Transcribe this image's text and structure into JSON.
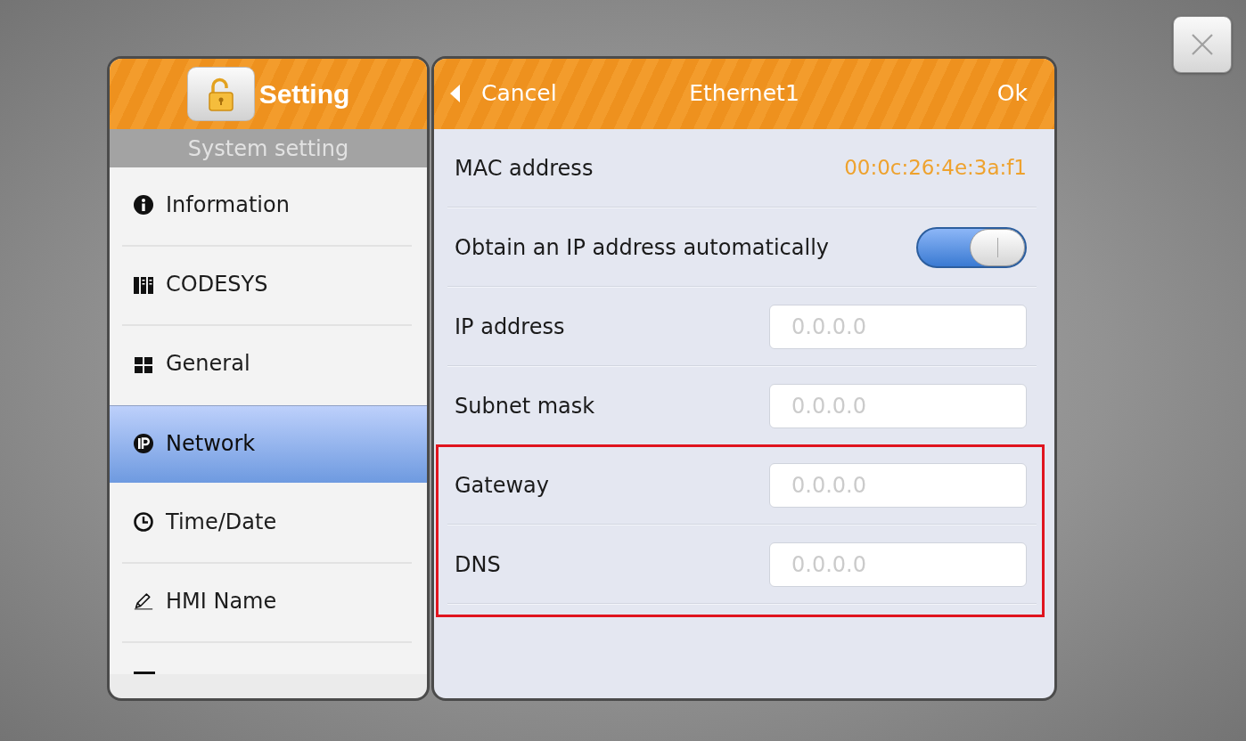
{
  "sidebar": {
    "title": "Setting",
    "subtitle": "System setting",
    "items": [
      {
        "label": "Information",
        "selected": false
      },
      {
        "label": "CODESYS",
        "selected": false
      },
      {
        "label": "General",
        "selected": false
      },
      {
        "label": "Network",
        "selected": true
      },
      {
        "label": "Time/Date",
        "selected": false
      },
      {
        "label": "HMI Name",
        "selected": false
      }
    ]
  },
  "detail": {
    "cancel": "Cancel",
    "title": "Ethernet1",
    "ok": "Ok",
    "fields": [
      {
        "kind": "info",
        "label": "MAC address",
        "value": "00:0c:26:4e:3a:f1",
        "highlighted": false
      },
      {
        "kind": "toggle",
        "label": "Obtain an IP address automatically",
        "on": true,
        "highlighted": false
      },
      {
        "kind": "input",
        "label": "IP address",
        "placeholder": "0.0.0.0",
        "highlighted": false
      },
      {
        "kind": "input",
        "label": "Subnet mask",
        "placeholder": "0.0.0.0",
        "highlighted": false
      },
      {
        "kind": "input",
        "label": "Gateway",
        "placeholder": "0.0.0.0",
        "highlighted": true
      },
      {
        "kind": "input",
        "label": "DNS",
        "placeholder": "0.0.0.0",
        "highlighted": true
      }
    ]
  }
}
